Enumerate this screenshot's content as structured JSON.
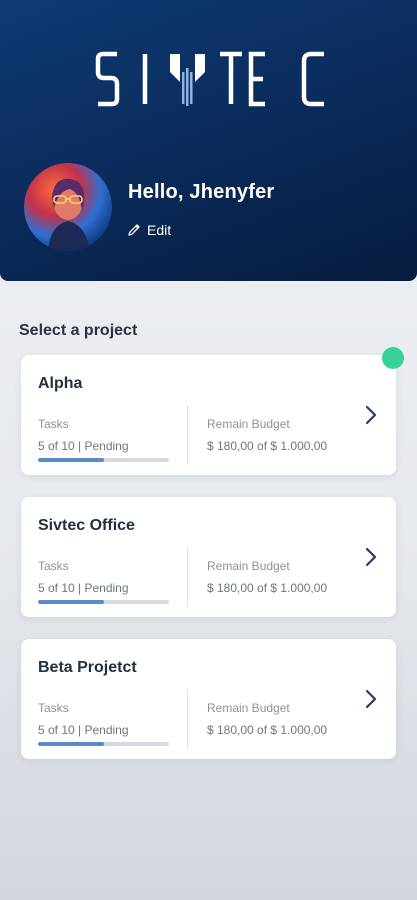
{
  "header": {
    "logo_text": "SIVTEC",
    "greeting": "Hello, Jhenyfer",
    "edit_label": "Edit",
    "avatar_alt": "user-avatar"
  },
  "section": {
    "title": "Select a project"
  },
  "colors": {
    "header_primary": "#0b2d5e",
    "accent_green": "#3ad19a",
    "progress_fill": "#5a8ac8"
  },
  "projects": [
    {
      "name": "Alpha",
      "tasks_label": "Tasks",
      "tasks_value": "5 of 10 | Pending",
      "progress": 0.5,
      "budget_label": "Remain Budget",
      "budget_value": "$ 180,00 of $ 1.000,00"
    },
    {
      "name": "Sivtec Office",
      "tasks_label": "Tasks",
      "tasks_value": "5 of 10 | Pending",
      "progress": 0.5,
      "budget_label": "Remain Budget",
      "budget_value": "$ 180,00 of $ 1.000,00"
    },
    {
      "name": "Beta Projetct",
      "tasks_label": "Tasks",
      "tasks_value": "5 of 10 | Pending",
      "progress": 0.5,
      "budget_label": "Remain Budget",
      "budget_value": "$ 180,00 of $ 1.000,00"
    }
  ]
}
